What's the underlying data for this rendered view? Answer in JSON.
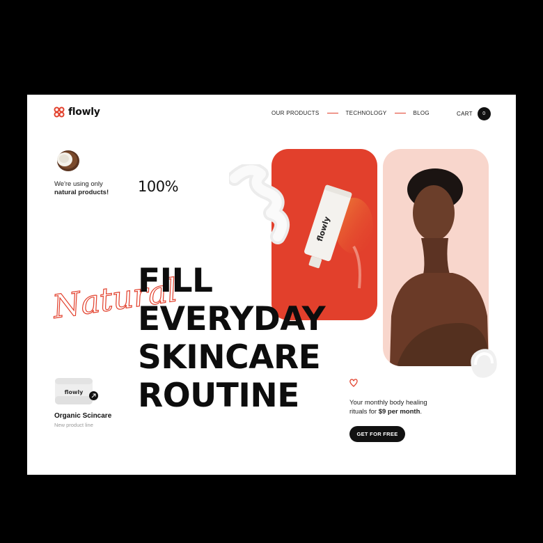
{
  "brand": {
    "name": "flowly",
    "accent": "#e2402c",
    "tube_brand": "flowly"
  },
  "nav": {
    "items": [
      "OUR PRODUCTS",
      "TECHNOLOGY",
      "BLOG"
    ]
  },
  "cart": {
    "label": "CART",
    "count": "0"
  },
  "natural": {
    "line1": "We're using only",
    "line2": "natural products!",
    "percent": "100%"
  },
  "script_word": "Natural",
  "headline": {
    "lines": [
      "FILL",
      "EVERYDAY",
      "SKINCARE",
      "ROUTINE"
    ]
  },
  "product": {
    "title": "Organic Scincare",
    "subtitle": "New product line",
    "jar_label": "flowly"
  },
  "offer": {
    "text": "Your monthly body healing",
    "text2_prefix": "rituals for ",
    "price": "$9 per month",
    "text2_suffix": "."
  },
  "cta": {
    "label": "GET FOR FREE"
  },
  "colors": {
    "pink_card": "#f8d6cc",
    "dark": "#111111"
  }
}
